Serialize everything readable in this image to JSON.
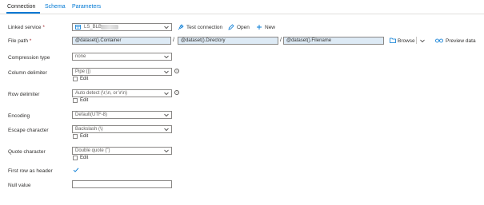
{
  "tabs": [
    {
      "label": "Connection"
    },
    {
      "label": "Schema"
    },
    {
      "label": "Parameters"
    }
  ],
  "linked_service": {
    "label": "Linked service",
    "required": "*",
    "value": "LS_BLB",
    "test_connection": "Test connection",
    "open": "Open",
    "new": "New"
  },
  "file_path": {
    "label": "File path",
    "required": "*",
    "container": "@dataset().Container",
    "directory": "@dataset().Directory",
    "filename": "@dataset().Filename",
    "separator": "/",
    "browse": "Browse",
    "preview": "Preview data"
  },
  "compression_type": {
    "label": "Compression type",
    "value": "none"
  },
  "column_delimiter": {
    "label": "Column delimiter",
    "value": "Pipe (|)",
    "edit": "Edit"
  },
  "row_delimiter": {
    "label": "Row delimiter",
    "value": "Auto detect (\\r,\\n, or \\r\\n)",
    "edit": "Edit"
  },
  "encoding": {
    "label": "Encoding",
    "value": "Default(UTF-8)"
  },
  "escape_character": {
    "label": "Escape character",
    "value": "Backslash (\\)",
    "edit": "Edit"
  },
  "quote_character": {
    "label": "Quote character",
    "value": "Double quote (\")",
    "edit": "Edit"
  },
  "first_row_header": {
    "label": "First row as header",
    "checked": true
  },
  "null_value": {
    "label": "Null value",
    "value": ""
  },
  "colors": {
    "accent": "#0078d4",
    "input_fill": "#ddeaf5",
    "border": "#8a8886"
  },
  "icons": [
    "table-icon",
    "test-connection-icon",
    "pencil-icon",
    "plus-icon",
    "folder-icon",
    "chevron-down-icon",
    "glasses-icon",
    "info-icon",
    "checkmark-icon"
  ]
}
